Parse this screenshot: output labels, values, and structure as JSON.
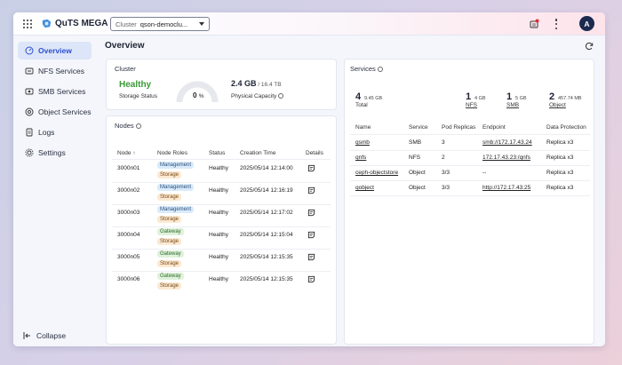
{
  "app": {
    "title": "QuTS MEGA"
  },
  "cluster_select": {
    "label": "Cluster",
    "value": "qson-democlu..."
  },
  "user": {
    "initial": "A"
  },
  "sidebar": {
    "items": [
      {
        "label": "Overview",
        "icon": "overview-icon",
        "active": true
      },
      {
        "label": "NFS Services",
        "icon": "nfs-icon"
      },
      {
        "label": "SMB Services",
        "icon": "smb-icon"
      },
      {
        "label": "Object Services",
        "icon": "object-icon"
      },
      {
        "label": "Logs",
        "icon": "logs-icon"
      },
      {
        "label": "Settings",
        "icon": "settings-icon"
      }
    ],
    "collapse_label": "Collapse"
  },
  "page": {
    "title": "Overview"
  },
  "cluster_card": {
    "title": "Cluster",
    "health": "Healthy",
    "storage_status_label": "Storage Status",
    "gauge_value": "0",
    "gauge_unit": "%",
    "used": "2.4 GB",
    "total": " / 16.4 TB",
    "capacity_label": "Physical Capacity"
  },
  "nodes_card": {
    "title": "Nodes",
    "columns": [
      "Node",
      "Node Roles",
      "Status",
      "Creation Time",
      "Details"
    ],
    "rows": [
      {
        "node": "3000n01",
        "roles": [
          "Management",
          "Storage"
        ],
        "status": "Healthy",
        "created": "2025/05/14 12:14:00"
      },
      {
        "node": "3000n02",
        "roles": [
          "Management",
          "Storage"
        ],
        "status": "Healthy",
        "created": "2025/05/14 12:16:19"
      },
      {
        "node": "3000n03",
        "roles": [
          "Management",
          "Storage"
        ],
        "status": "Healthy",
        "created": "2025/05/14 12:17:02"
      },
      {
        "node": "3000n04",
        "roles": [
          "Gateway",
          "Storage"
        ],
        "status": "Healthy",
        "created": "2025/05/14 12:15:04"
      },
      {
        "node": "3000n05",
        "roles": [
          "Gateway",
          "Storage"
        ],
        "status": "Healthy",
        "created": "2025/05/14 12:15:35"
      },
      {
        "node": "3000n06",
        "roles": [
          "Gateway",
          "Storage"
        ],
        "status": "Healthy",
        "created": "2025/05/14 12:15:35"
      }
    ]
  },
  "services_card": {
    "title": "Services",
    "stats": [
      {
        "count": "4",
        "size": "9.45 GB",
        "label": "Total"
      },
      {
        "count": "1",
        "size": "4 GB",
        "label": "NFS"
      },
      {
        "count": "1",
        "size": "5 GB",
        "label": "SMB"
      },
      {
        "count": "2",
        "size": "457.74 MB",
        "label": "Object"
      }
    ],
    "columns": [
      "Name",
      "Service",
      "Pod Replicas",
      "Endpoint",
      "Data Protection"
    ],
    "rows": [
      {
        "name": "qsmb",
        "service": "SMB",
        "replicas": "3",
        "endpoint": "smb://172.17.43.24",
        "protection": "Replica x3"
      },
      {
        "name": "qnfs",
        "service": "NFS",
        "replicas": "2",
        "endpoint": "172.17.43.23:/qnfs",
        "protection": "Replica x3"
      },
      {
        "name": "ceph-objectstore",
        "service": "Object",
        "replicas": "3/3",
        "endpoint": "--",
        "protection": "Replica x3"
      },
      {
        "name": "qobject",
        "service": "Object",
        "replicas": "3/3",
        "endpoint": "http://172.17.43:25",
        "protection": "Replica x3"
      }
    ]
  },
  "colors": {
    "accent": "#2b4fd0",
    "healthy": "#3a9a38",
    "avatar_bg": "#1b2a4e"
  }
}
